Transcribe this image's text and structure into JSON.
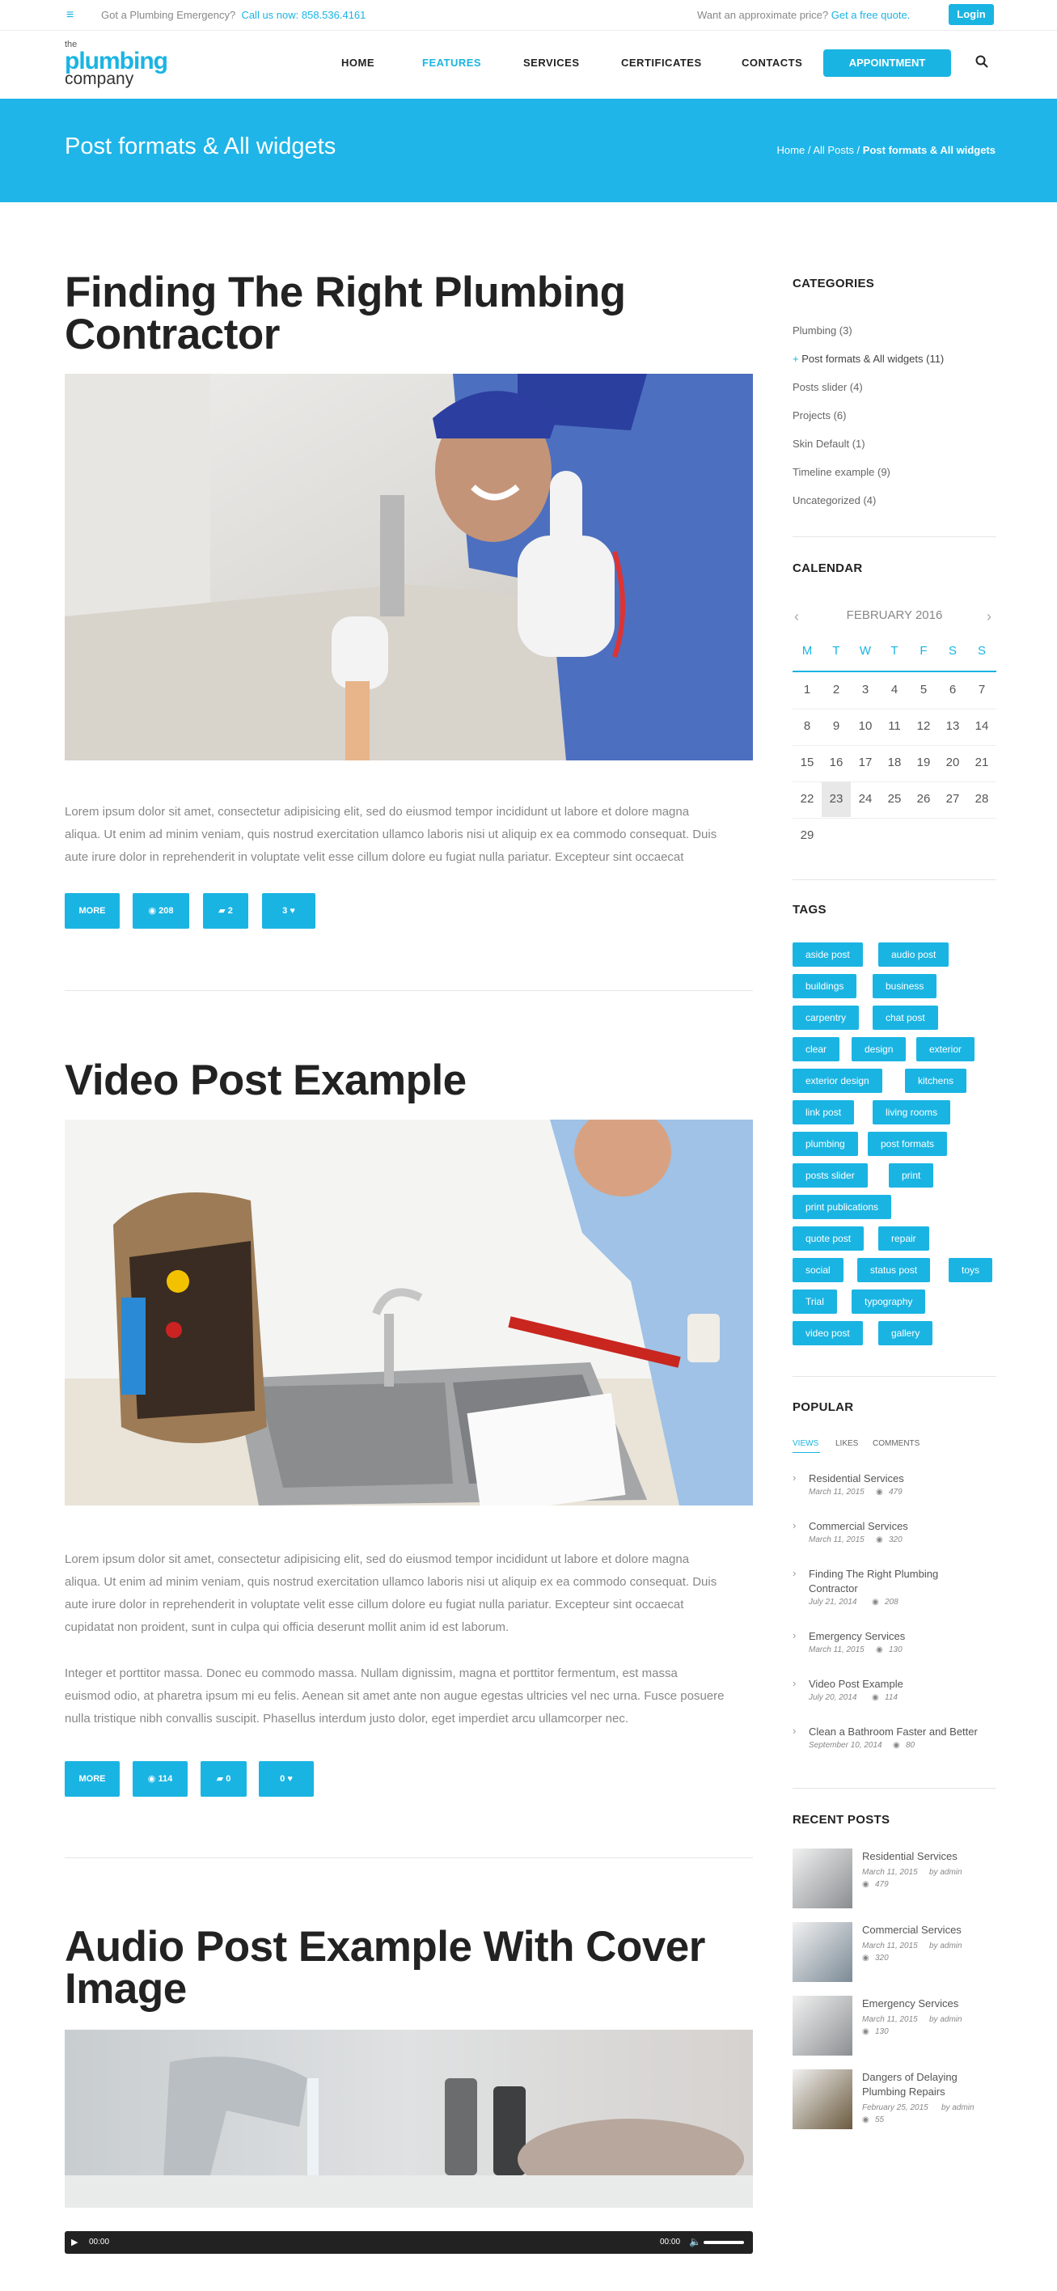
{
  "topbar": {
    "emergency_text": "Got a Plumbing Emergency?",
    "call_text": "Call us now: 858.536.4161",
    "quote_question": "Want an approximate price?",
    "quote_link": "Get a free quote.",
    "login_label": "Login"
  },
  "logo": {
    "the": "the",
    "plumbing": "plumbing",
    "company": "company"
  },
  "nav": {
    "items": [
      {
        "label": "HOME"
      },
      {
        "label": "FEATURES"
      },
      {
        "label": "SERVICES"
      },
      {
        "label": "CERTIFICATES"
      },
      {
        "label": "CONTACTS"
      }
    ],
    "appointment_label": "APPOINTMENT"
  },
  "banner": {
    "title": "Post formats & All widgets",
    "breadcrumb": {
      "home": "Home",
      "sep1": " / ",
      "all_posts": "All Posts",
      "sep2": " / ",
      "current": "Post formats & All widgets"
    }
  },
  "posts": [
    {
      "title_l1": "Finding The Right Plumbing",
      "title_l2": "Contractor",
      "paragraphs": [
        [
          "Lorem ipsum dolor sit amet, consectetur adipisicing elit, sed do eiusmod tempor incididunt ut labore et dolore magna",
          "aliqua. Ut enim ad minim veniam, quis nostrud exercitation ullamco laboris nisi ut aliquip ex ea commodo consequat. Duis",
          "aute irure dolor in reprehenderit in voluptate velit esse cillum dolore eu fugiat nulla pariatur. Excepteur sint occaecat"
        ]
      ],
      "more": "MORE",
      "views": "208",
      "comments": "2",
      "likes": "3"
    },
    {
      "title_l1": "Video Post Example",
      "paragraphs": [
        [
          "Lorem ipsum dolor sit amet, consectetur adipisicing elit, sed do eiusmod tempor incididunt ut labore et dolore magna",
          "aliqua. Ut enim ad minim veniam, quis nostrud exercitation ullamco laboris nisi ut aliquip ex ea commodo consequat. Duis",
          "aute irure dolor in reprehenderit in voluptate velit esse cillum dolore eu fugiat nulla pariatur. Excepteur sint occaecat",
          "cupidatat non proident, sunt in culpa qui officia deserunt mollit anim id est laborum."
        ],
        [
          "Integer et porttitor massa. Donec eu commodo massa. Nullam dignissim, magna et porttitor fermentum, est massa",
          "euismod odio, at pharetra ipsum mi eu felis. Aenean sit amet ante non augue egestas ultricies vel nec urna. Fusce posuere",
          "nulla tristique nibh convallis suscipit. Phasellus interdum justo dolor, eget imperdiet arcu ullamcorper nec."
        ]
      ],
      "more": "MORE",
      "views": "114",
      "comments": "0",
      "likes": "0"
    },
    {
      "title_l1": "Audio Post Example With Cover",
      "title_l2": "Image",
      "audio": {
        "current": "00:00",
        "duration": "00:00"
      }
    }
  ],
  "sidebar": {
    "categories": {
      "title": "CATEGORIES",
      "items": [
        {
          "label": "Plumbing (3)"
        },
        {
          "label": "Post formats & All widgets (11)",
          "bullet": "+"
        },
        {
          "label": "Posts slider (4)"
        },
        {
          "label": "Projects (6)"
        },
        {
          "label": "Skin Default (1)"
        },
        {
          "label": "Timeline example (9)"
        },
        {
          "label": "Uncategorized (4)"
        }
      ]
    },
    "calendar": {
      "title": "CALENDAR",
      "month": "FEBRUARY 2016",
      "prev": "‹",
      "next": "›",
      "weekdays": [
        "M",
        "T",
        "W",
        "T",
        "F",
        "S",
        "S"
      ],
      "days": [
        "1",
        "2",
        "3",
        "4",
        "5",
        "6",
        "7",
        "8",
        "9",
        "10",
        "11",
        "12",
        "13",
        "14",
        "15",
        "16",
        "17",
        "18",
        "19",
        "20",
        "21",
        "22",
        "23",
        "24",
        "25",
        "26",
        "27",
        "28",
        "29"
      ],
      "today": "23"
    },
    "tags": {
      "title": "TAGS",
      "items": [
        "aside post",
        "audio post",
        "buildings",
        "business",
        "carpentry",
        "chat post",
        "clear",
        "design",
        "exterior",
        "exterior design",
        "kitchens",
        "link post",
        "living rooms",
        "plumbing",
        "post formats",
        "posts slider",
        "print",
        "print publications",
        "quote post",
        "repair",
        "social",
        "status post",
        "toys",
        "Trial",
        "typography",
        "video post",
        "gallery"
      ]
    },
    "popular": {
      "title": "POPULAR",
      "tabs": [
        "VIEWS",
        "LIKES",
        "COMMENTS"
      ],
      "items": [
        {
          "title_l1": "Residential Services",
          "date": "March 11, 2015",
          "views": "479"
        },
        {
          "title_l1": "Commercial Services",
          "date": "March 11, 2015",
          "views": "320"
        },
        {
          "title_l1": "Finding The Right Plumbing",
          "title_l2": "Contractor",
          "date": "July 21, 2014",
          "views": "208"
        },
        {
          "title_l1": "Emergency Services",
          "date": "March 11, 2015",
          "views": "130"
        },
        {
          "title_l1": "Video Post Example",
          "date": "July 20, 2014",
          "views": "114"
        },
        {
          "title_l1": "Clean a Bathroom Faster and Better",
          "date": "September 10, 2014",
          "views": "80"
        }
      ]
    },
    "recent": {
      "title": "RECENT POSTS",
      "items": [
        {
          "title_l1": "Residential Services",
          "date": "March 11, 2015",
          "by": "by admin",
          "views": "479"
        },
        {
          "title_l1": "Commercial Services",
          "date": "March 11, 2015",
          "by": "by admin",
          "views": "320"
        },
        {
          "title_l1": "Emergency Services",
          "date": "March 11, 2015",
          "by": "by admin",
          "views": "130"
        },
        {
          "title_l1": "Dangers of Delaying",
          "title_l2": "Plumbing Repairs",
          "date": "February 25, 2015",
          "by": "by admin",
          "views": "55"
        }
      ]
    }
  },
  "colors": {
    "accent": "#1ab4e3",
    "banner": "#1fb5e8",
    "heading": "#222222",
    "text": "#888888"
  }
}
